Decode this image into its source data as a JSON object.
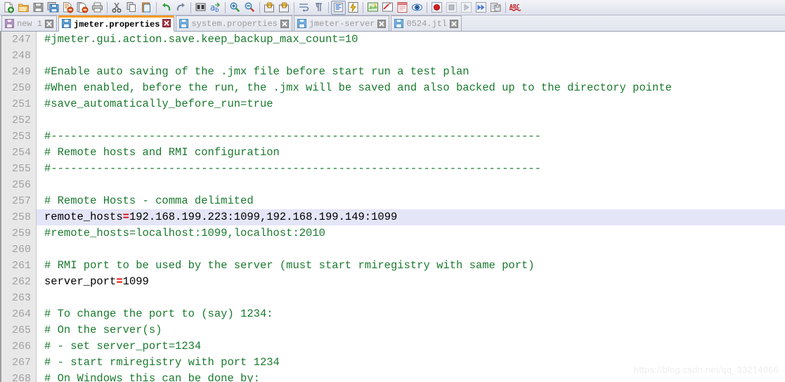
{
  "toolbar": {
    "groups": [
      [
        {
          "name": "new-file-icon",
          "label": "New"
        },
        {
          "name": "open-folder-icon",
          "label": "Open"
        },
        {
          "name": "save-icon",
          "label": "Save"
        },
        {
          "name": "save-all-icon",
          "label": "Save All"
        },
        {
          "name": "close-file-icon",
          "label": "Close"
        },
        {
          "name": "close-all-icon",
          "label": "Close All"
        },
        {
          "name": "print-icon",
          "label": "Print"
        }
      ],
      [
        {
          "name": "cut-icon",
          "label": "Cut"
        },
        {
          "name": "copy-icon",
          "label": "Copy"
        },
        {
          "name": "paste-icon",
          "label": "Paste"
        }
      ],
      [
        {
          "name": "undo-icon",
          "label": "Undo"
        },
        {
          "name": "redo-icon",
          "label": "Redo"
        }
      ],
      [
        {
          "name": "find-in-files-icon",
          "label": "Find in Files"
        },
        {
          "name": "replace-icon",
          "label": "Replace"
        }
      ],
      [
        {
          "name": "zoom-in-icon",
          "label": "Zoom In"
        },
        {
          "name": "zoom-out-icon",
          "label": "Zoom Out"
        }
      ],
      [
        {
          "name": "sync-vertical-icon",
          "label": "Sync Vertical Scrolling"
        },
        {
          "name": "sync-horizontal-icon",
          "label": "Sync Horizontal Scrolling"
        }
      ],
      [
        {
          "name": "word-wrap-icon",
          "label": "Word Wrap"
        },
        {
          "name": "show-all-characters-icon",
          "label": "Show All Characters"
        }
      ],
      [
        {
          "name": "indent-guide-icon",
          "label": "Indent Guide"
        },
        {
          "name": "show-symbol-icon",
          "label": "Show Symbol"
        }
      ],
      [
        {
          "name": "user-defined-language-icon",
          "label": "User Defined Language"
        },
        {
          "name": "document-map-icon",
          "label": "Document Map"
        },
        {
          "name": "function-list-icon",
          "label": "Function List"
        },
        {
          "name": "document-switcher-icon",
          "label": "Document Switcher"
        }
      ],
      [
        {
          "name": "record-macro-icon",
          "label": "Start Recording"
        },
        {
          "name": "stop-macro-icon",
          "label": "Stop Recording"
        },
        {
          "name": "play-macro-icon",
          "label": "Playback"
        },
        {
          "name": "run-macro-multiple-icon",
          "label": "Run a Macro Multiple Times"
        },
        {
          "name": "save-macro-icon",
          "label": "Save Current Recorded Macro"
        }
      ],
      [
        {
          "name": "spell-check-icon",
          "label": "Spell Check"
        }
      ]
    ]
  },
  "tabs": [
    {
      "label": "new 1",
      "active": false,
      "icon": "floppy-icon",
      "close": "close-icon"
    },
    {
      "label": "jmeter.properties",
      "active": true,
      "icon": "floppy-icon",
      "close": "close-icon"
    },
    {
      "label": "system.properties",
      "active": false,
      "icon": "floppy-icon",
      "close": "close-icon"
    },
    {
      "label": "jmeter-server",
      "active": false,
      "icon": "floppy-icon",
      "close": "close-icon"
    },
    {
      "label": "0524.jtl",
      "active": false,
      "icon": "floppy-icon",
      "close": "close-icon"
    }
  ],
  "editor": {
    "lines": [
      {
        "num": "247",
        "text": "#jmeter.gui.action.save.keep_backup_max_count=10",
        "highlight": false
      },
      {
        "num": "248",
        "text": "",
        "highlight": false
      },
      {
        "num": "249",
        "text": "#Enable auto saving of the .jmx file before start run a test plan",
        "highlight": false
      },
      {
        "num": "250",
        "text": "#When enabled, before the run, the .jmx will be saved and also backed up to the directory pointe",
        "highlight": false
      },
      {
        "num": "251",
        "text": "#save_automatically_before_run=true",
        "highlight": false
      },
      {
        "num": "252",
        "text": "",
        "highlight": false
      },
      {
        "num": "253",
        "text": "#---------------------------------------------------------------------------",
        "highlight": false
      },
      {
        "num": "254",
        "text": "# Remote hosts and RMI configuration",
        "highlight": false
      },
      {
        "num": "255",
        "text": "#---------------------------------------------------------------------------",
        "highlight": false
      },
      {
        "num": "256",
        "text": "",
        "highlight": false
      },
      {
        "num": "257",
        "text": "# Remote Hosts - comma delimited",
        "highlight": false
      },
      {
        "num": "258",
        "key": "remote_hosts",
        "eq": "=",
        "value": "192.168.199.223:1099,192.168.199.149:1099",
        "highlight": true
      },
      {
        "num": "259",
        "text": "#remote_hosts=localhost:1099,localhost:2010",
        "highlight": false
      },
      {
        "num": "260",
        "text": "",
        "highlight": false
      },
      {
        "num": "261",
        "text": "# RMI port to be used by the server (must start rmiregistry with same port)",
        "highlight": false
      },
      {
        "num": "262",
        "key": "server_port",
        "eq": "=",
        "value": "1099",
        "highlight": false
      },
      {
        "num": "263",
        "text": "",
        "highlight": false
      },
      {
        "num": "264",
        "text": "# To change the port to (say) 1234:",
        "highlight": false
      },
      {
        "num": "265",
        "text": "# On the server(s)",
        "highlight": false
      },
      {
        "num": "266",
        "text": "# - set server_port=1234",
        "highlight": false
      },
      {
        "num": "267",
        "text": "# - start rmiregistry with port 1234",
        "highlight": false
      },
      {
        "num": "268",
        "text": "# On Windows this can be done by:",
        "highlight": false
      }
    ]
  },
  "watermark": {
    "text": "https://blog.csdn.net/qq_33214066"
  },
  "colors": {
    "comment_green": "#1a7a2e",
    "key_black": "#000000",
    "equals_red": "#e00000",
    "line_number_gray": "#a0a0a0",
    "gutter_bg": "#e8e8e8",
    "highlight_bg": "#e4e5f7",
    "active_tab_accent": "#f49a1c",
    "editor_bg": "#ffffff"
  }
}
